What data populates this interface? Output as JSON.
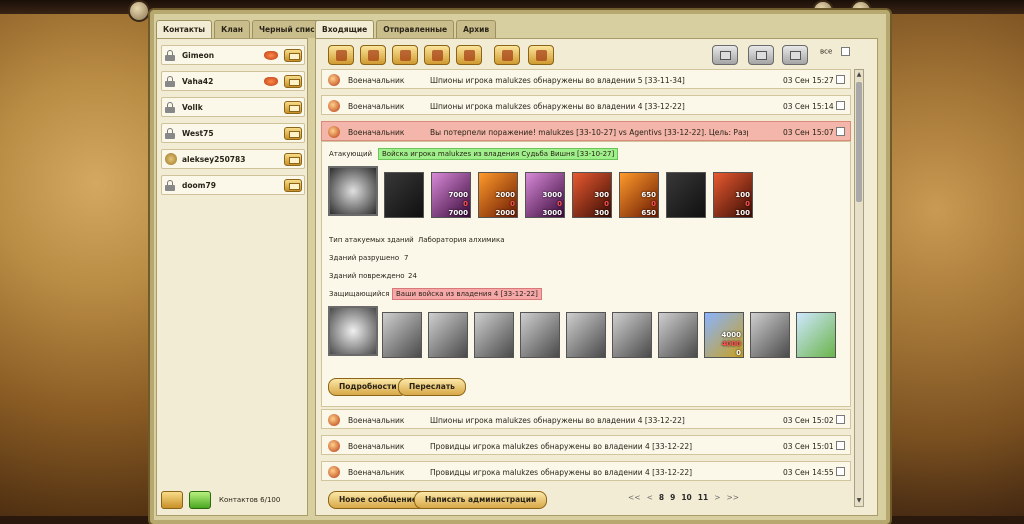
{
  "left_tabs": [
    "Контакты",
    "Клан",
    "Черный список"
  ],
  "contacts": [
    {
      "name": "Gimeon",
      "gift": true,
      "avatar": false
    },
    {
      "name": "Vaha42",
      "gift": true,
      "avatar": false
    },
    {
      "name": "Vollk",
      "gift": false,
      "avatar": false
    },
    {
      "name": "West75",
      "gift": false,
      "avatar": false
    },
    {
      "name": "aleksey250783",
      "gift": false,
      "avatar": true
    },
    {
      "name": "doom79",
      "gift": false,
      "avatar": false
    }
  ],
  "contacts_count": "Контактов 6/100",
  "right_tabs": [
    "Входящие",
    "Отправленные",
    "Архив"
  ],
  "select_all_label": "все",
  "messages": [
    {
      "from": "Военачальник",
      "subject": "Шпионы игрока malukzes обнаружены во владении 5 [33-11-34]",
      "date": "03 Сен 15:27"
    },
    {
      "from": "Военачальник",
      "subject": "Шпионы игрока malukzes обнаружены во владении 4 [33-12-22]",
      "date": "03 Сен 15:14"
    },
    {
      "from": "Военачальник",
      "subject": "Вы потерпели поражение! malukzes [33-10-27] vs Agentivs [33-12-22]. Цель: Разрушение зд...",
      "date": "03 Сен 15:07",
      "selected": true
    },
    {
      "from": "Военачальник",
      "subject": "Шпионы игрока malukzes обнаружены во владении 4 [33-12-22]",
      "date": "03 Сен 15:02"
    },
    {
      "from": "Военачальник",
      "subject": "Провидцы игрока malukzes обнаружены во владении 4 [33-12-22]",
      "date": "03 Сен 15:01"
    },
    {
      "from": "Военачальник",
      "subject": "Провидцы игрока malukzes обнаружены во владении 4 [33-12-22]",
      "date": "03 Сен 14:55"
    }
  ],
  "report": {
    "attacker_label": "Атакующий",
    "attacker_value": "Войска игрока malukzes из владения Судьба Вишня [33-10-27]",
    "attacker_units": [
      {
        "type": "d",
        "nums": []
      },
      {
        "type": "p",
        "nums": [
          "7000",
          "0",
          "7000"
        ]
      },
      {
        "type": "f",
        "nums": [
          "2000",
          "0",
          "2000"
        ]
      },
      {
        "type": "p",
        "nums": [
          "3000",
          "0",
          "3000"
        ]
      },
      {
        "type": "r",
        "nums": [
          "300",
          "0",
          "300"
        ]
      },
      {
        "type": "f",
        "nums": [
          "650",
          "0",
          "650"
        ]
      },
      {
        "type": "d",
        "nums": []
      },
      {
        "type": "r",
        "nums": [
          "100",
          "0",
          "100"
        ]
      }
    ],
    "building_type_label": "Тип атакуемых зданий",
    "building_type_value": "Лаборатория алхимика",
    "destroyed_label": "Зданий разрушено",
    "destroyed_value": "7",
    "damaged_label": "Зданий повреждено",
    "damaged_value": "24",
    "defender_label": "Защищающийся",
    "defender_value": "Ваши войска из владения 4 [33-12-22]",
    "defender_units": [
      {
        "type": "gr",
        "nums": []
      },
      {
        "type": "gr",
        "nums": []
      },
      {
        "type": "gr",
        "nums": []
      },
      {
        "type": "gr",
        "nums": []
      },
      {
        "type": "gr",
        "nums": []
      },
      {
        "type": "gr",
        "nums": []
      },
      {
        "type": "gr",
        "nums": []
      },
      {
        "type": "b",
        "nums": [
          "4000",
          "4000",
          "0"
        ]
      },
      {
        "type": "gr",
        "nums": []
      },
      {
        "type": "s",
        "nums": []
      }
    ],
    "details_button": "Подробности",
    "forward_button": "Переслать"
  },
  "new_message_button": "Новое сообщение",
  "write_admin_button": "Написать администрации",
  "pager": [
    "<<",
    "<",
    "8",
    "9",
    "10",
    "11",
    ">",
    ">>"
  ]
}
